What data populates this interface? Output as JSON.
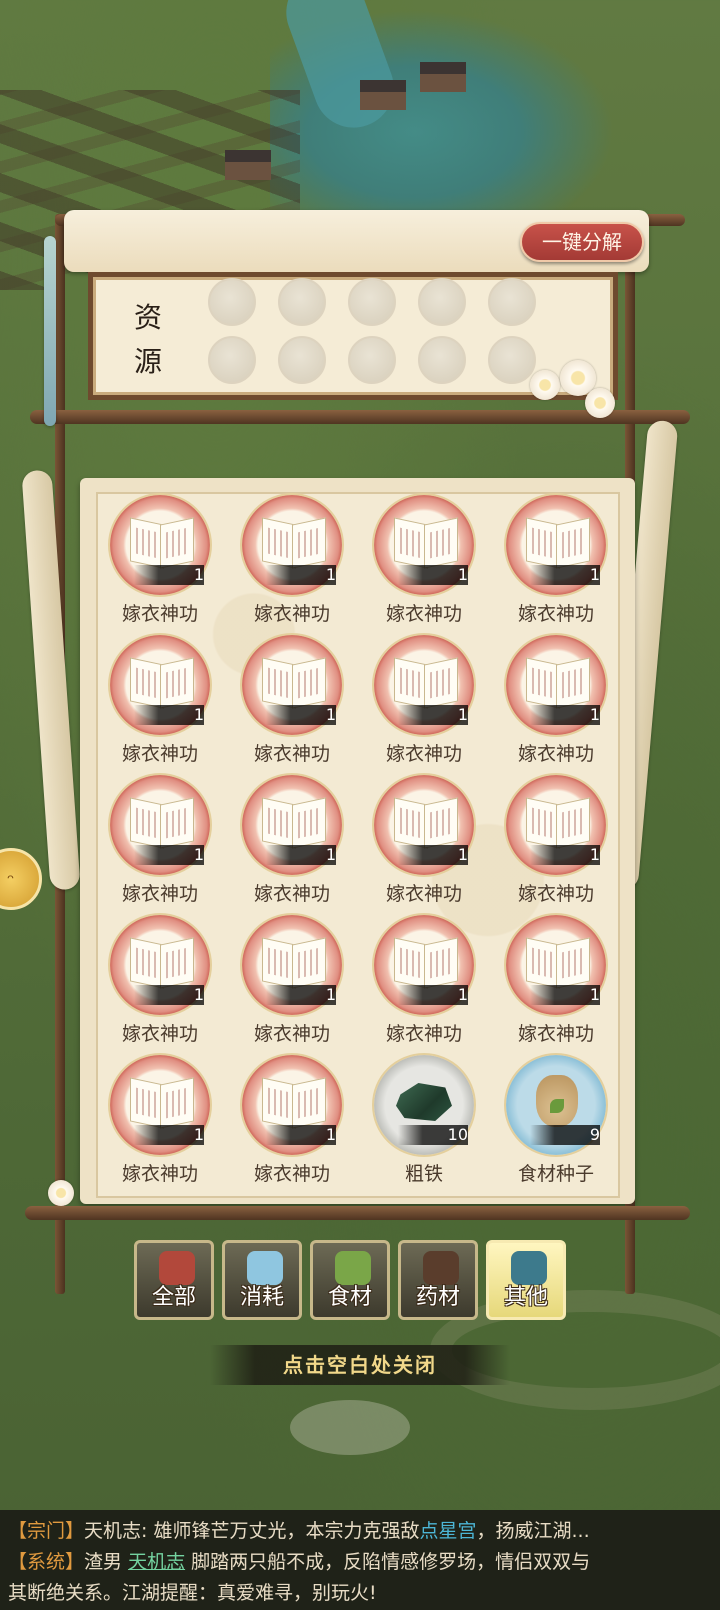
{
  "panel": {
    "decompose_label": "一键分解",
    "resource_title": "资\n源",
    "resource_slots_count": 10
  },
  "items": [
    {
      "name": "嫁衣神功",
      "count": "1",
      "icon": "book-icon"
    },
    {
      "name": "嫁衣神功",
      "count": "1",
      "icon": "book-icon"
    },
    {
      "name": "嫁衣神功",
      "count": "1",
      "icon": "book-icon"
    },
    {
      "name": "嫁衣神功",
      "count": "1",
      "icon": "book-icon"
    },
    {
      "name": "嫁衣神功",
      "count": "1",
      "icon": "book-icon"
    },
    {
      "name": "嫁衣神功",
      "count": "1",
      "icon": "book-icon"
    },
    {
      "name": "嫁衣神功",
      "count": "1",
      "icon": "book-icon"
    },
    {
      "name": "嫁衣神功",
      "count": "1",
      "icon": "book-icon"
    },
    {
      "name": "嫁衣神功",
      "count": "1",
      "icon": "book-icon"
    },
    {
      "name": "嫁衣神功",
      "count": "1",
      "icon": "book-icon"
    },
    {
      "name": "嫁衣神功",
      "count": "1",
      "icon": "book-icon"
    },
    {
      "name": "嫁衣神功",
      "count": "1",
      "icon": "book-icon"
    },
    {
      "name": "嫁衣神功",
      "count": "1",
      "icon": "book-icon"
    },
    {
      "name": "嫁衣神功",
      "count": "1",
      "icon": "book-icon"
    },
    {
      "name": "嫁衣神功",
      "count": "1",
      "icon": "book-icon"
    },
    {
      "name": "嫁衣神功",
      "count": "1",
      "icon": "book-icon"
    },
    {
      "name": "嫁衣神功",
      "count": "1",
      "icon": "book-icon"
    },
    {
      "name": "嫁衣神功",
      "count": "1",
      "icon": "book-icon"
    },
    {
      "name": "粗铁",
      "count": "10",
      "icon": "ore-icon"
    },
    {
      "name": "食材种子",
      "count": "9",
      "icon": "seed-sack-icon"
    }
  ],
  "tabs": [
    {
      "label": "全部",
      "icon": "treasure-chest-icon",
      "active": false,
      "color": "#b2483b"
    },
    {
      "label": "消耗",
      "icon": "potion-bottle-icon",
      "active": false,
      "color": "#8fc6e0"
    },
    {
      "label": "食材",
      "icon": "vegetable-basket-icon",
      "active": false,
      "color": "#7aa648"
    },
    {
      "label": "药材",
      "icon": "medicine-pot-icon",
      "active": false,
      "color": "#5a3d2c"
    },
    {
      "label": "其他",
      "icon": "pouch-icon",
      "active": true,
      "color": "#3d7a8c"
    }
  ],
  "close_hint": "点击空白处关闭",
  "chat": {
    "lines": [
      {
        "tag": "【宗门】",
        "parts": [
          {
            "text": "天机志: 雄师锋芒万丈光，本宗力克强敌",
            "style": "name"
          },
          {
            "text": "点星宫",
            "style": "link"
          },
          {
            "text": "，扬威江湖...",
            "style": "name"
          }
        ]
      },
      {
        "tag": "【系统】",
        "parts": [
          {
            "text": "渣男 ",
            "style": "name"
          },
          {
            "text": "天机志",
            "style": "link-u"
          },
          {
            "text": " 脚踏两只船不成，反陷情感修罗场，情侣双双与",
            "style": "name"
          }
        ]
      },
      {
        "tag": "",
        "parts": [
          {
            "text": "其断绝关系。江湖提醒：真爱难寻，别玩火!",
            "style": "name"
          }
        ]
      }
    ]
  },
  "colors": {
    "accent_red": "#b5443e",
    "parchment": "#f3ead3",
    "wood": "#6e4a2e",
    "chat_tag": "#e09a3f",
    "chat_link": "#4cb6d6"
  }
}
